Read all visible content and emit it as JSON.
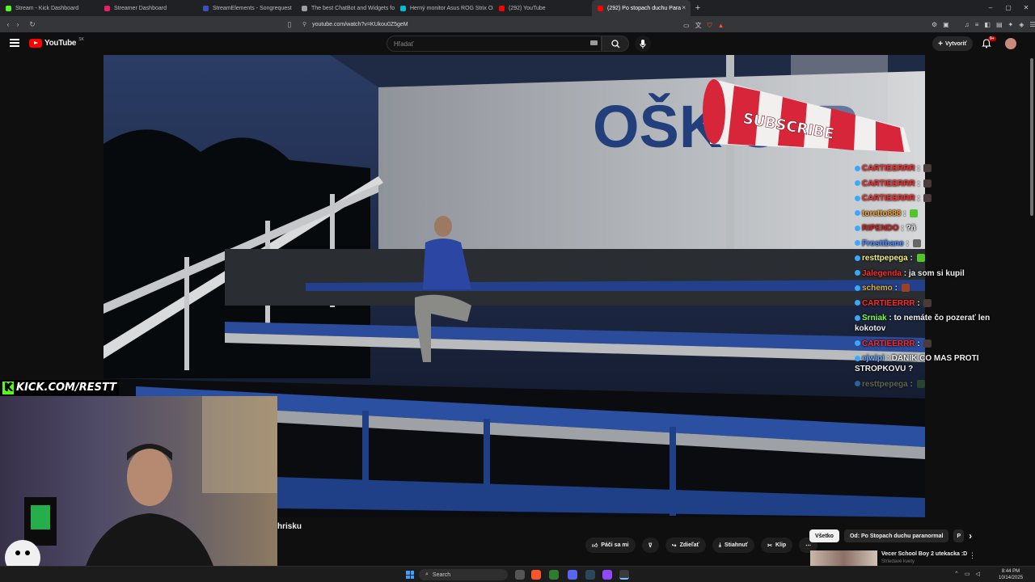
{
  "tabs": [
    {
      "label": "Stream - Kick Dashboard",
      "color": "#53fc18"
    },
    {
      "label": "Streamer Dashboard",
      "color": "#e91e63"
    },
    {
      "label": "StreamElements - Songrequest",
      "color": "#3f51b5"
    },
    {
      "label": "The best ChatBot and Widgets for K",
      "color": "#9e9e9e"
    },
    {
      "label": "Herný monitor Asus ROG Strix OLED",
      "color": "#00bcd4"
    },
    {
      "label": "(292) YouTube",
      "color": "#ff0000"
    },
    {
      "label": "(292) Po stopach duchu Para",
      "color": "#ff0000",
      "active": true
    }
  ],
  "address": {
    "url": "youtube.com/watch?v=KUkou0Z5geM"
  },
  "youtube": {
    "logo": "YouTube",
    "country": "SK",
    "search_placeholder": "Hľadať",
    "create_label": "Vytvoriť",
    "notifications": "9+"
  },
  "overlay": {
    "subscribe_text": "SUBSCRIBE",
    "wall_text": "OŠK STR",
    "kick_text": "KICK.COM/RESTT"
  },
  "chat": [
    {
      "user": "CARTIEERRR",
      "color": "#ff2a2a",
      "text": "",
      "emote": "#4a3a3a"
    },
    {
      "user": "CARTIEERRR",
      "color": "#ff2a2a",
      "text": "",
      "emote": "#4a3a3a"
    },
    {
      "user": "CARTIEERRR",
      "color": "#ff2a2a",
      "text": "",
      "emote": "#4a3a3a"
    },
    {
      "user": "toretto888",
      "color": "#f0a030",
      "text": "",
      "emote": "#53c42a"
    },
    {
      "user": "RIPENDO",
      "color": "#d02020",
      "text": "?ñ",
      "emote": ""
    },
    {
      "user": "Frosttbane",
      "color": "#4a8cff",
      "text": "",
      "emote": "#666"
    },
    {
      "user": "resttpepega",
      "color": "#f0f080",
      "text": "",
      "emote": "#53c42a"
    },
    {
      "user": "Jalegenda",
      "color": "#ff2a2a",
      "text": "ja som si kupil",
      "emote": ""
    },
    {
      "user": "schemo",
      "color": "#e8b030",
      "text": "",
      "emote": "#a04020"
    },
    {
      "user": "CARTIEERRR",
      "color": "#ff2a2a",
      "text": "",
      "emote": "#4a3a3a"
    },
    {
      "user": "Srniak",
      "color": "#7dff4a",
      "text": "to nemáte čo pozerať len kokotov",
      "emote": ""
    },
    {
      "user": "CARTIEERRR",
      "color": "#ff2a2a",
      "text": "",
      "emote": "#4a3a3a"
    },
    {
      "user": "ejwipi",
      "color": "#6aa8ff",
      "text": "DANIK CO MAS PROTI STROPKOVU ?",
      "emote": ""
    },
    {
      "user": "resttpepega",
      "color": "#a8a860",
      "text": "",
      "emote": "#3a6a2a"
    }
  ],
  "video": {
    "title_fragment": "hrisku"
  },
  "actions": {
    "like": "Páči sa mi",
    "share": "Zdieľať",
    "download": "Stiahnuť",
    "clip": "Klip"
  },
  "chips": [
    "Všetko",
    "Od: Po Stopach duchu paranormal",
    "P"
  ],
  "recommendation": {
    "title": "Vecer School Boy 2 utekacka :D",
    "subtitle": "Striedavé kvety"
  },
  "taskbar": {
    "search": "Search",
    "time": "8:44 PM",
    "date": "10/14/2025"
  }
}
